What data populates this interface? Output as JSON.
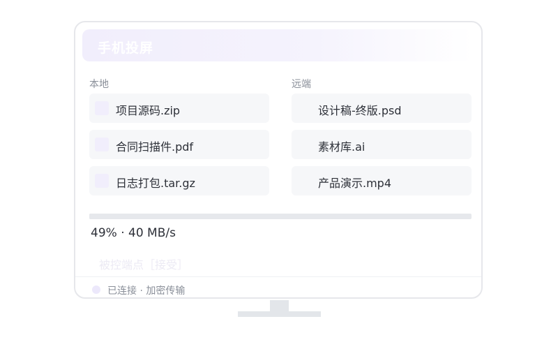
{
  "window": {
    "title": "手机投屏"
  },
  "local": {
    "label": "本地",
    "files": [
      {
        "name": "项目源码.zip",
        "icon": "file-icon"
      },
      {
        "name": "合同扫描件.pdf",
        "icon": "file-icon"
      },
      {
        "name": "日志打包.tar.gz",
        "icon": "file-icon"
      }
    ]
  },
  "remote": {
    "label": "远端",
    "files": [
      {
        "name": "设计稿-终版.psd"
      },
      {
        "name": "素材库.ai"
      },
      {
        "name": "产品演示.mp4"
      }
    ]
  },
  "transfer": {
    "progress_percent": 49,
    "progress_text": "49% · 40 MB/s"
  },
  "controlled": {
    "text": "被控端点［接受］"
  },
  "status": {
    "text": "已连接 · 加密传输"
  },
  "colors": {
    "accent_light": "#f1eefc",
    "card_bg": "#f6f7f9",
    "text_primary": "#2d3038",
    "text_secondary": "#8a8f99",
    "border": "#e6e7eb"
  }
}
